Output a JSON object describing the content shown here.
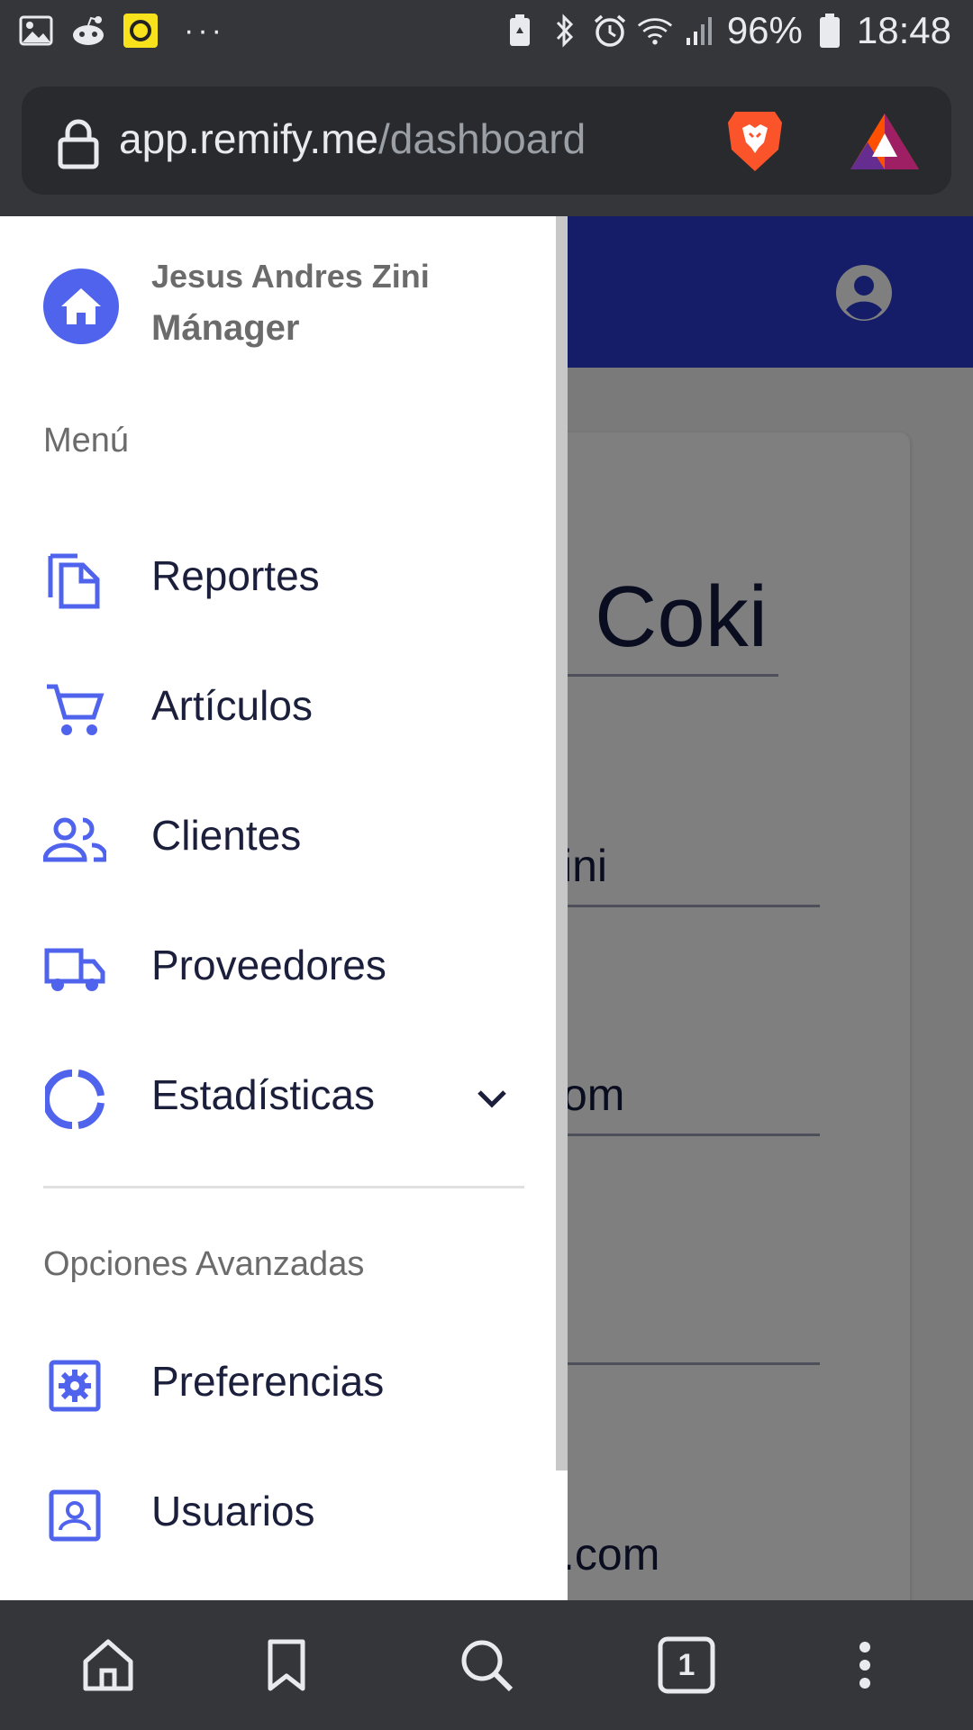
{
  "status_bar": {
    "battery": "96%",
    "time": "18:48",
    "notification_icons": [
      "gallery-icon",
      "reddit-icon",
      "yellow-app-icon"
    ],
    "more": "···"
  },
  "browser": {
    "url_domain": "app.remify.me",
    "url_path": "/dashboard"
  },
  "page": {
    "title_fragment": "Coki",
    "field_fragments": [
      "ini",
      "om",
      ".com"
    ],
    "header_color": "#2a3bd1"
  },
  "drawer": {
    "user_name": "Jesus Andres Zini",
    "user_role": "Mánager",
    "menu_section_title": "Menú",
    "menu_items": [
      {
        "label": "Reportes",
        "icon": "file-copy-icon"
      },
      {
        "label": "Artículos",
        "icon": "cart-icon"
      },
      {
        "label": "Clientes",
        "icon": "people-icon"
      },
      {
        "label": "Proveedores",
        "icon": "truck-icon"
      },
      {
        "label": "Estadísticas",
        "icon": "donut-chart-icon"
      }
    ],
    "advanced_section_title": "Opciones Avanzadas",
    "advanced_items": [
      {
        "label": "Preferencias",
        "icon": "settings-box-icon"
      },
      {
        "label": "Usuarios",
        "icon": "contact-card-icon"
      }
    ],
    "accent_color": "#4f63ec"
  },
  "bottom_nav": {
    "tab_count": "1",
    "buttons": [
      "home-icon",
      "bookmark-icon",
      "search-icon",
      "tabs-icon",
      "more-vert-icon"
    ]
  }
}
